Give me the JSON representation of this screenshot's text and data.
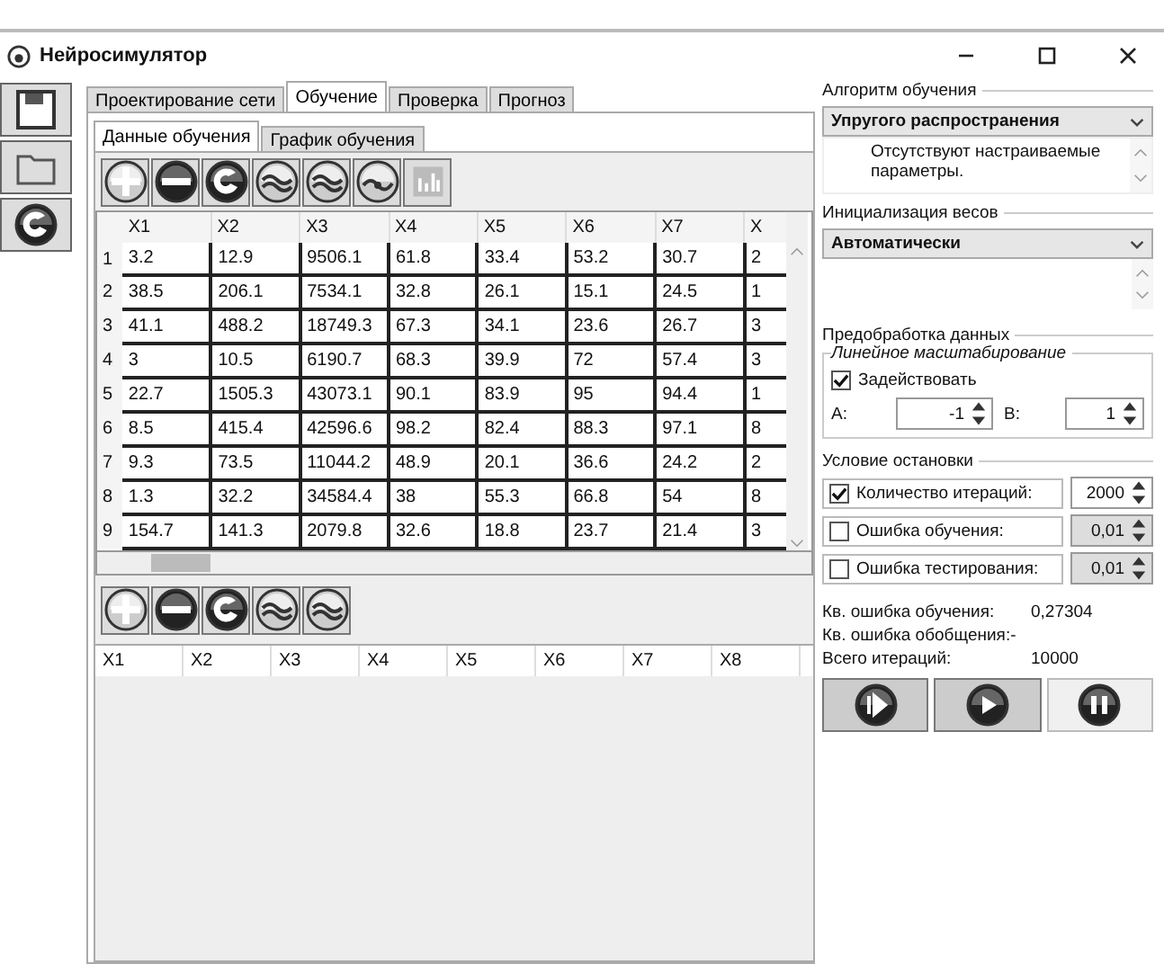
{
  "window": {
    "title": "Нейросимулятор"
  },
  "tabs": [
    {
      "label": "Проектирование сети",
      "selected": false
    },
    {
      "label": "Обучение",
      "selected": true
    },
    {
      "label": "Проверка",
      "selected": false
    },
    {
      "label": "Прогноз",
      "selected": false
    }
  ],
  "subtabs": [
    {
      "label": "Данные обучения",
      "selected": true
    },
    {
      "label": "График обучения",
      "selected": false
    }
  ],
  "data_table": {
    "columns": [
      "X1",
      "X2",
      "X3",
      "X4",
      "X5",
      "X6",
      "X7",
      "X"
    ],
    "rows": [
      {
        "index": "1",
        "cells": [
          "3.2",
          "12.9",
          "9506.1",
          "61.8",
          "33.4",
          "53.2",
          "30.7",
          "2"
        ]
      },
      {
        "index": "2",
        "cells": [
          "38.5",
          "206.1",
          "7534.1",
          "32.8",
          "26.1",
          "15.1",
          "24.5",
          "1"
        ]
      },
      {
        "index": "3",
        "cells": [
          "41.1",
          "488.2",
          "18749.3",
          "67.3",
          "34.1",
          "23.6",
          "26.7",
          "3"
        ]
      },
      {
        "index": "4",
        "cells": [
          "3",
          "10.5",
          "6190.7",
          "68.3",
          "39.9",
          "72",
          "57.4",
          "3"
        ]
      },
      {
        "index": "5",
        "cells": [
          "22.7",
          "1505.3",
          "43073.1",
          "90.1",
          "83.9",
          "95",
          "94.4",
          "1"
        ]
      },
      {
        "index": "6",
        "cells": [
          "8.5",
          "415.4",
          "42596.6",
          "98.2",
          "82.4",
          "88.3",
          "97.1",
          "8"
        ]
      },
      {
        "index": "7",
        "cells": [
          "9.3",
          "73.5",
          "11044.2",
          "48.9",
          "20.1",
          "36.6",
          "24.2",
          "2"
        ]
      },
      {
        "index": "8",
        "cells": [
          "1.3",
          "32.2",
          "34584.4",
          "38",
          "55.3",
          "66.8",
          "54",
          "8"
        ]
      },
      {
        "index": "9",
        "cells": [
          "154.7",
          "141.3",
          "2079.8",
          "32.6",
          "18.8",
          "23.7",
          "21.4",
          "3"
        ]
      }
    ]
  },
  "test_table": {
    "columns": [
      "X1",
      "X2",
      "X3",
      "X4",
      "X5",
      "X6",
      "X7",
      "X8"
    ]
  },
  "algorithm": {
    "title": "Алгоритм обучения",
    "value": "Упругого распространения",
    "note": "Отсутствуют настраиваемые параметры."
  },
  "init": {
    "title": "Инициализация весов",
    "value": "Автоматически"
  },
  "preprocessing": {
    "title": "Предобработка данных",
    "subtitle": "Линейное масштабирование",
    "enable": {
      "label": "Задействовать",
      "checked": true
    },
    "a_label": "A:",
    "a_value": "-1",
    "b_label": "B:",
    "b_value": "1"
  },
  "stop": {
    "title": "Условие остановки",
    "conditions": [
      {
        "label": "Количество итераций:",
        "checked": true,
        "value": "2000"
      },
      {
        "label": "Ошибка обучения:",
        "checked": false,
        "value": "0,01"
      },
      {
        "label": "Ошибка тестирования:",
        "checked": false,
        "value": "0,01"
      }
    ]
  },
  "stats": [
    {
      "label": "Кв. ошибка обучения:",
      "value": "0,27304"
    },
    {
      "label": "Кв. ошибка обобщения:-"
    },
    {
      "label": "Всего итераций:",
      "value": "10000"
    }
  ]
}
